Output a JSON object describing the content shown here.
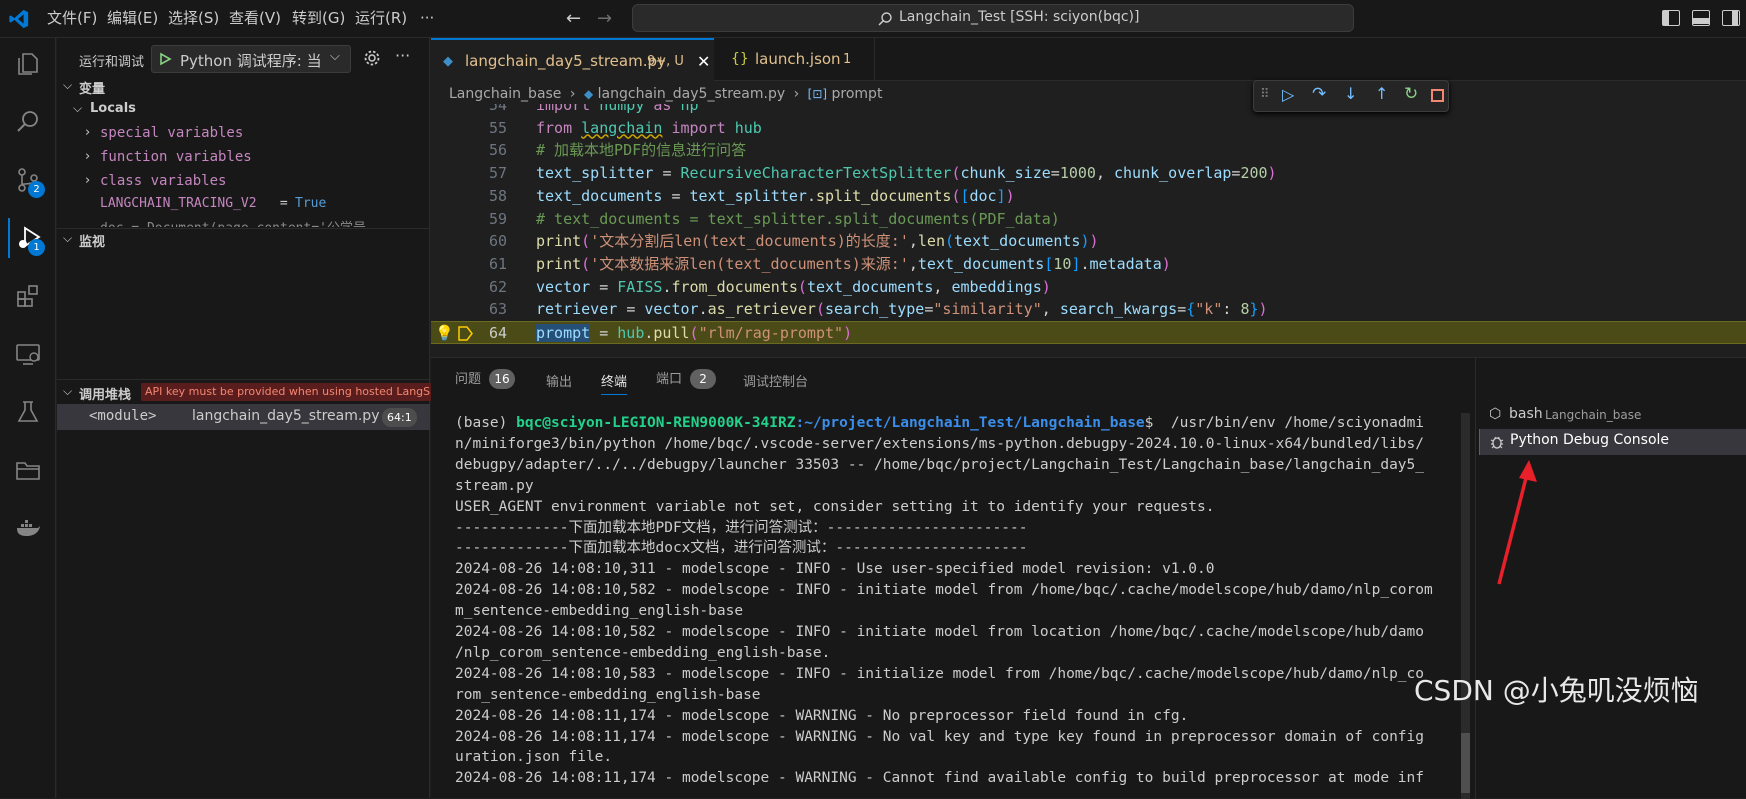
{
  "title_bar": {
    "menus": [
      "文件(F)",
      "编辑(E)",
      "选择(S)",
      "查看(V)",
      "转到(G)",
      "运行(R)",
      "···"
    ],
    "search_text": "Langchain_Test [SSH: sciyon(bqc)]"
  },
  "activity_bar": {
    "scm_badge": "2",
    "debug_badge": "1"
  },
  "sidebar": {
    "header_title": "运行和调试",
    "config_label": "Python 调试程序: 当",
    "variables_title": "变量",
    "locals_title": "Locals",
    "locals_items": [
      "special variables",
      "function variables",
      "class variables"
    ],
    "var_name": "LANGCHAIN_TRACING_V2",
    "var_eq": " = ",
    "var_value": "True",
    "var_cut": "doc = Document(page_content='公学号",
    "watch_title": "监视",
    "callstack_title": "调用堆栈",
    "callstack_error": "API key must be provided when using hosted LangSmi...",
    "stack_frame": "<module>",
    "stack_file": "langchain_day5_stream.py",
    "stack_pos": "64:1"
  },
  "editor": {
    "tabs": [
      {
        "name": "langchain_day5_stream.py",
        "status": "9+, U"
      },
      {
        "name": "launch.json",
        "status": "1"
      }
    ],
    "breadcrumb": [
      "Langchain_base",
      "langchain_day5_stream.py",
      "prompt"
    ],
    "lines": [
      {
        "n": "54",
        "text": "import numpy as np"
      },
      {
        "n": "55",
        "text": "from langchain import hub"
      },
      {
        "n": "56",
        "text": "# 加载本地PDF的信息进行问答"
      },
      {
        "n": "57",
        "text": "text_splitter = RecursiveCharacterTextSplitter(chunk_size=1000, chunk_overlap=200)"
      },
      {
        "n": "58",
        "text": "text_documents = text_splitter.split_documents([doc])"
      },
      {
        "n": "59",
        "text": "# text_documents = text_splitter.split_documents(PDF_data)"
      },
      {
        "n": "60",
        "text": "print('文本分割后len(text_documents)的长度:',len(text_documents))"
      },
      {
        "n": "61",
        "text": "print('文本数据来源len(text_documents)来源:',text_documents[10].metadata)"
      },
      {
        "n": "62",
        "text": "vector = FAISS.from_documents(text_documents, embeddings)"
      },
      {
        "n": "63",
        "text": "retriever = vector.as_retriever(search_type=\"similarity\", search_kwargs={\"k\": 8})"
      },
      {
        "n": "64",
        "text": "prompt = hub.pull(\"rlm/rag-prompt\")"
      }
    ]
  },
  "panel": {
    "tabs": [
      {
        "label": "问题",
        "count": "16"
      },
      {
        "label": "输出",
        "count": ""
      },
      {
        "label": "终端",
        "count": ""
      },
      {
        "label": "端口",
        "count": "2"
      },
      {
        "label": "调试控制台",
        "count": ""
      }
    ],
    "terminal_prompt_env": "(base) ",
    "terminal_prompt_user": "bqc@sciyon-LEGION-REN9000K-34IRZ",
    "terminal_prompt_path": ":~/project/Langchain_Test/Langchain_base",
    "terminal_prompt_cmd": "$  /usr/bin/env /home/sciyonadmi",
    "terminal_lines": [
      "n/miniforge3/bin/python /home/bqc/.vscode-server/extensions/ms-python.debugpy-2024.10.0-linux-x64/bundled/libs/",
      "debugpy/adapter/../../debugpy/launcher 33503 -- /home/bqc/project/Langchain_Test/Langchain_base/langchain_day5_",
      "stream.py",
      "USER_AGENT environment variable not set, consider setting it to identify your requests.",
      "-------------下面加载本地PDF文档，进行问答测试：-----------------------",
      "-------------下面加载本地docx文档，进行问答测试：----------------------",
      "2024-08-26 14:08:10,311 - modelscope - INFO - Use user-specified model revision: v1.0.0",
      "2024-08-26 14:08:10,582 - modelscope - INFO - initiate model from /home/bqc/.cache/modelscope/hub/damo/nlp_corom",
      "m_sentence-embedding_english-base",
      "2024-08-26 14:08:10,582 - modelscope - INFO - initiate model from location /home/bqc/.cache/modelscope/hub/damo",
      "/nlp_corom_sentence-embedding_english-base.",
      "2024-08-26 14:08:10,583 - modelscope - INFO - initialize model from /home/bqc/.cache/modelscope/hub/damo/nlp_co",
      "rom_sentence-embedding_english-base",
      "2024-08-26 14:08:11,174 - modelscope - WARNING - No preprocessor field found in cfg.",
      "2024-08-26 14:08:11,174 - modelscope - WARNING - No val key and type key found in preprocessor domain of config",
      "uration.json file.",
      "2024-08-26 14:08:11,174 - modelscope - WARNING - Cannot find available config to build preprocessor at mode inf"
    ],
    "term_list": [
      {
        "name": "bash",
        "sub": "Langchain_base"
      },
      {
        "name": "Python Debug Console",
        "sub": ""
      }
    ],
    "accent_arrow_color": "#e8202a"
  },
  "watermark": "CSDN @小兔叽没烦恼"
}
